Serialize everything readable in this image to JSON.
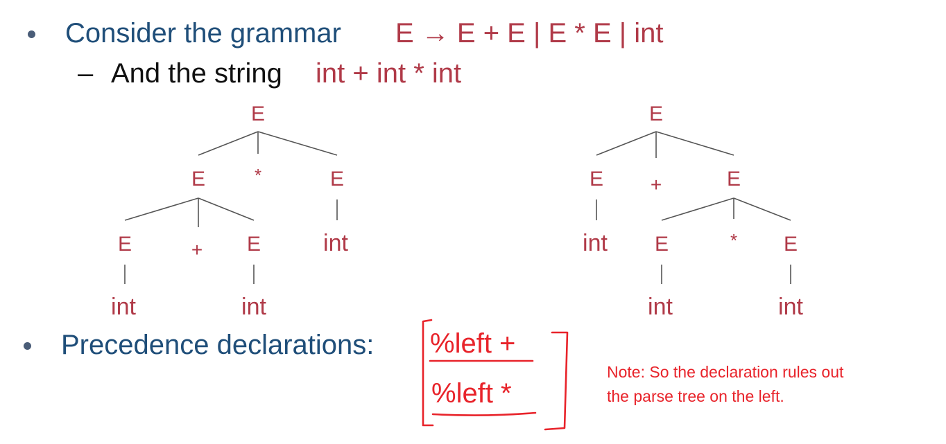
{
  "bullet1": {
    "text": "Consider the grammar",
    "production": "E → E + E | E  * E | int"
  },
  "bullet2": {
    "dash": "–",
    "text": "And the string",
    "string": "int + int * int"
  },
  "trees": {
    "left": {
      "root": "E",
      "level1": [
        "E",
        "*",
        "E"
      ],
      "level2": [
        "E",
        "+",
        "E",
        "int"
      ],
      "level3": [
        "int",
        "int"
      ]
    },
    "right": {
      "root": "E",
      "level1": [
        "E",
        "+",
        "E"
      ],
      "level2": [
        "int",
        "E",
        "*",
        "E"
      ],
      "level3": [
        "int",
        "int"
      ]
    }
  },
  "bullet3": {
    "text": "Precedence declarations:"
  },
  "declarations": [
    "%left  +",
    "%left  *"
  ],
  "note": {
    "line1": "Note: So the declaration rules out",
    "line2": "the parse tree on the left."
  },
  "colors": {
    "bullet_blue": "#1f4e79",
    "grammar_red": "#b03a48",
    "annotation_red": "#e8232a"
  }
}
